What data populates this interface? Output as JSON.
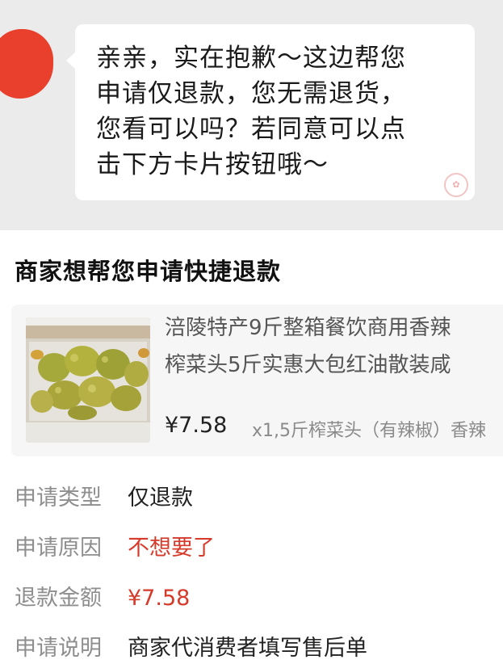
{
  "chat": {
    "message": "亲亲，实在抱歉～这边帮您申请仅退款，您无需退货，您看可以吗？若同意可以点击下方卡片按钮哦～",
    "message_lines": [
      "亲亲，实在抱歉～这边帮您",
      "申请仅退款，您无需退货，",
      "您看可以吗？若同意可以点",
      "击下方卡片按钮哦～"
    ],
    "stamp_icon": "seal-stamp-icon"
  },
  "card": {
    "title": "商家想帮您申请快捷退款",
    "product": {
      "title_line1": "涪陵特产9斤整箱餐饮商用香辣",
      "title_line2": "榨菜头5斤实惠大包红油散装咸",
      "price": "¥7.58",
      "spec": "x1,5斤榨菜头（有辣椒）香辣"
    },
    "details": [
      {
        "label": "申请类型",
        "value": "仅退款",
        "highlight": false
      },
      {
        "label": "申请原因",
        "value": "不想要了",
        "highlight": true
      },
      {
        "label": "退款金额",
        "value": "¥7.58",
        "highlight": true
      },
      {
        "label": "申请说明",
        "value": "商家代消费者填写售后单",
        "highlight": false
      }
    ]
  },
  "colors": {
    "chat_bg": "#ebebeb",
    "bubble_bg": "#ffffff",
    "accent_red": "#d63a2a",
    "label_gray": "#8e8e8e"
  }
}
